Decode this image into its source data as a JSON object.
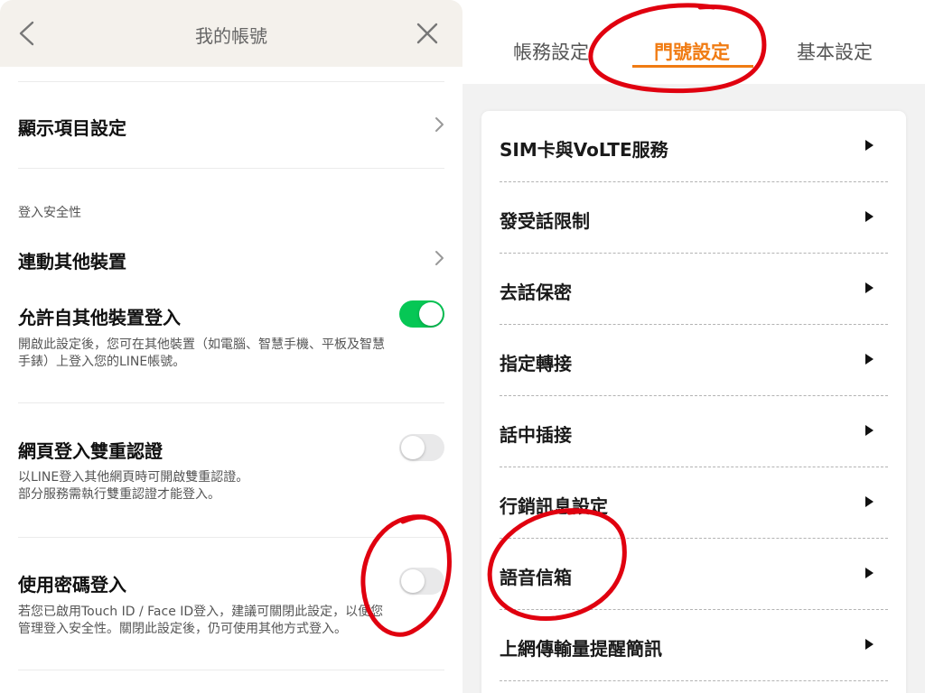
{
  "left": {
    "header": {
      "title": "我的帳號",
      "back_icon": "chevron-left-icon",
      "close_icon": "close-icon"
    },
    "rows": {
      "display_settings": "顯示項目設定",
      "security_section_label": "登入安全性",
      "link_devices": "連動其他裝置",
      "allow_other_devices_title": "允許自其他裝置登入",
      "allow_other_devices_desc_line1": "開啟此設定後，您可在其他裝置（如電腦、智慧手機、平板及智慧",
      "allow_other_devices_desc_line2": "手錶）上登入您的LINE帳號。",
      "allow_other_devices_on": true,
      "web_2fa_title": "網頁登入雙重認證",
      "web_2fa_desc_line1": "以LINE登入其他網頁時可開啟雙重認證。",
      "web_2fa_desc_line2": "部分服務需執行雙重認證才能登入。",
      "web_2fa_on": false,
      "password_login_title": "使用密碼登入",
      "password_login_desc_line1": "若您已啟用Touch ID / Face ID登入，建議可關閉此設定，以便您",
      "password_login_desc_line2": "管理登入安全性。關閉此設定後，仍可使用其他方式登入。",
      "password_login_on": false
    },
    "colors": {
      "toggle_on": "#06c755",
      "toggle_off": "#e9e9ea"
    }
  },
  "right": {
    "tabs": [
      {
        "label": "帳務設定",
        "active": false
      },
      {
        "label": "門號設定",
        "active": true
      },
      {
        "label": "基本設定",
        "active": false
      }
    ],
    "items": [
      "SIM卡與VoLTE服務",
      "發受話限制",
      "去話保密",
      "指定轉接",
      "話中插接",
      "行銷訊息設定",
      "語音信箱",
      "上網傳輸量提醒簡訊"
    ],
    "colors": {
      "accent": "#f07b12"
    }
  },
  "annotations": {
    "color": "#e0000f"
  }
}
